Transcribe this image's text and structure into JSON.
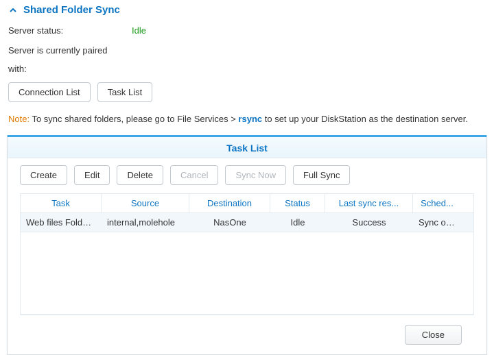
{
  "header": {
    "title": "Shared Folder Sync"
  },
  "status": {
    "label": "Server status:",
    "value": "Idle"
  },
  "paired": {
    "line1": "Server is currently paired",
    "line2": "with:"
  },
  "topButtons": {
    "connection_list": "Connection List",
    "task_list": "Task List"
  },
  "note": {
    "prefix": "Note:",
    "text_before": " To sync shared folders, please go to File Services > ",
    "link": "rsync",
    "text_after": " to set up your DiskStation as the destination server."
  },
  "dialog": {
    "title": "Task List",
    "toolbar": {
      "create": "Create",
      "edit": "Edit",
      "delete": "Delete",
      "cancel": "Cancel",
      "sync_now": "Sync Now",
      "full_sync": "Full Sync"
    },
    "columns": {
      "task": "Task",
      "source": "Source",
      "destination": "Destination",
      "status": "Status",
      "last_sync": "Last sync res...",
      "schedule": "Sched..."
    },
    "rows": [
      {
        "task": "Web files Folder ...",
        "source": "internal,molehole",
        "destination": "NasOne",
        "status": "Idle",
        "last_sync": "Success",
        "schedule": "Sync on ..."
      }
    ],
    "close": "Close"
  }
}
